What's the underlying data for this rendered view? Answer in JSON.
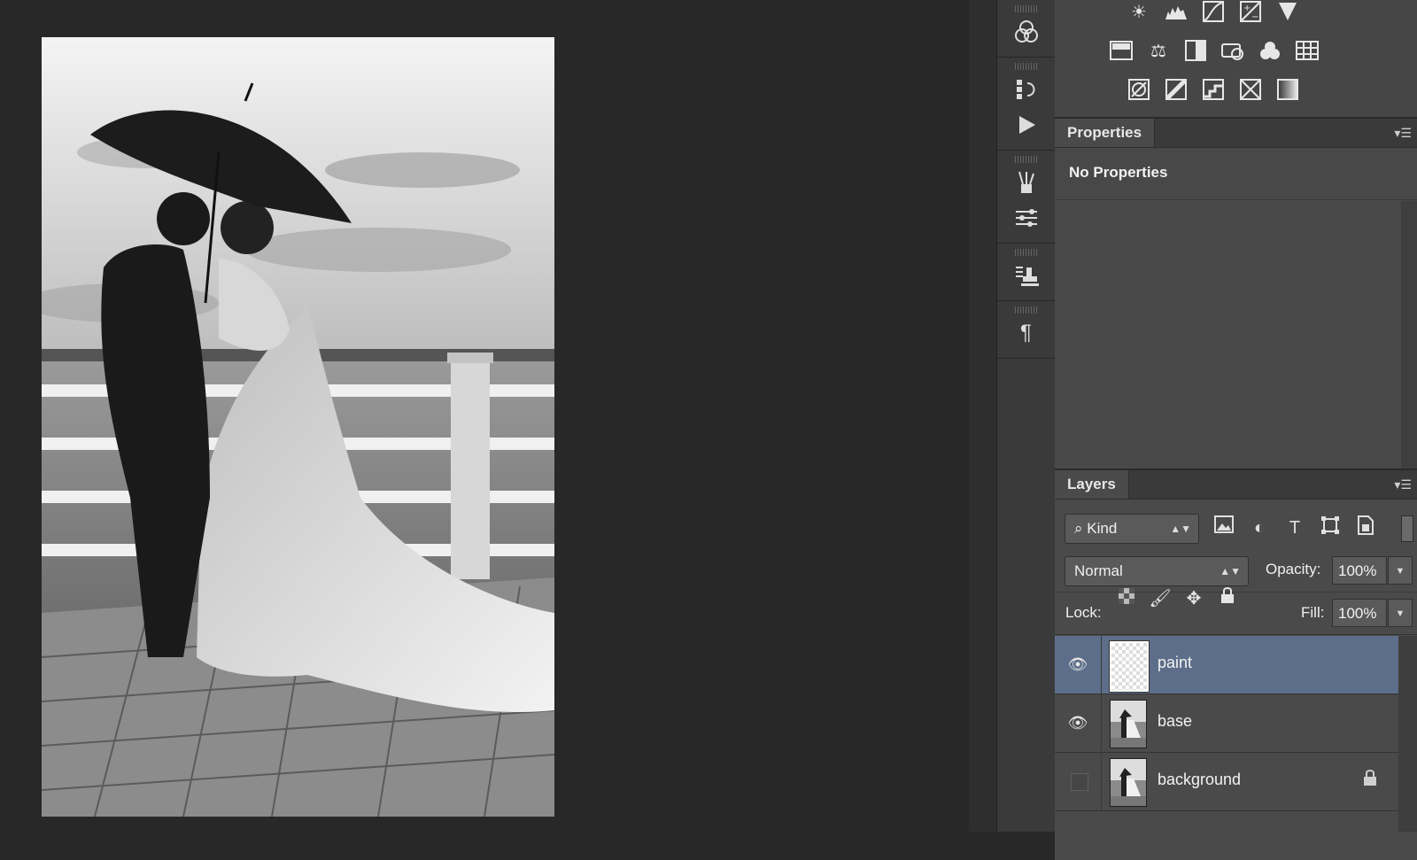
{
  "document": {
    "description_icon": "wedding-photo"
  },
  "dock": {
    "icons": [
      "channels-icon",
      "history-icon",
      "actions-play-icon",
      "brushes-icon",
      "brush-presets-icon",
      "clone-source-icon",
      "paragraph-icon"
    ]
  },
  "adjustments": {
    "row1": [
      "brightness-contrast-icon",
      "levels-icon",
      "curves-icon",
      "exposure-icon",
      "vibrance-icon"
    ],
    "row2": [
      "hue-saturation-icon",
      "color-balance-icon",
      "black-white-icon",
      "photo-filter-icon",
      "channel-mixer-icon",
      "color-lookup-icon"
    ],
    "row3": [
      "invert-icon",
      "posterize-icon",
      "threshold-icon",
      "selective-color-icon",
      "gradient-map-icon"
    ]
  },
  "properties": {
    "tab_label": "Properties",
    "body_text": "No Properties"
  },
  "layers": {
    "tab_label": "Layers",
    "filter_kind": "Kind",
    "blend_mode": "Normal",
    "opacity_label": "Opacity:",
    "opacity_value": "100%",
    "lock_label": "Lock:",
    "fill_label": "Fill:",
    "fill_value": "100%",
    "items": [
      {
        "name": "paint",
        "visible": true,
        "selected": true,
        "locked": false
      },
      {
        "name": "base",
        "visible": true,
        "selected": false,
        "locked": false
      },
      {
        "name": "background",
        "visible": false,
        "selected": false,
        "locked": true
      }
    ]
  }
}
